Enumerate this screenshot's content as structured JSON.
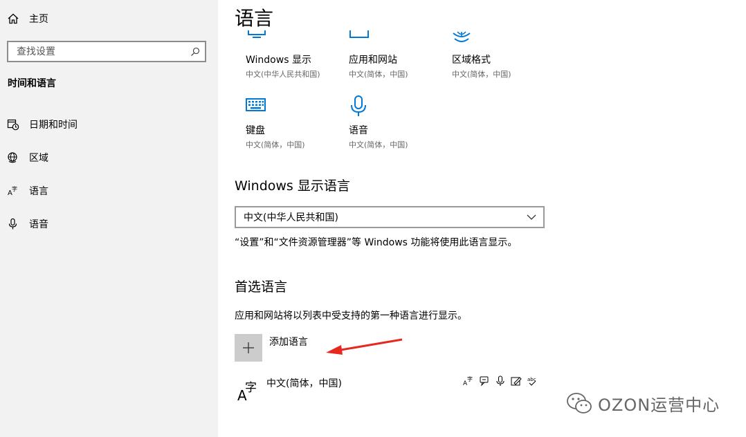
{
  "sidebar": {
    "home_label": "主页",
    "search_placeholder": "查找设置",
    "section_title": "时间和语言",
    "items": [
      {
        "label": "日期和时间"
      },
      {
        "label": "区域"
      },
      {
        "label": "语言"
      },
      {
        "label": "语音"
      }
    ]
  },
  "main": {
    "title": "语言",
    "tiles": [
      {
        "name": "Windows 显示",
        "sub": "中文(中华人民共和国)",
        "icon": "monitor-icon"
      },
      {
        "name": "应用和网站",
        "sub": "中文(简体，中国)",
        "icon": "window-icon"
      },
      {
        "name": "区域格式",
        "sub": "中文(简体，中国)",
        "icon": "globe-icon"
      },
      {
        "name": "键盘",
        "sub": "中文(简体，中国)",
        "icon": "keyboard-icon"
      },
      {
        "name": "语音",
        "sub": "中文(简体，中国)",
        "icon": "microphone-icon"
      }
    ],
    "display_language": {
      "heading": "Windows 显示语言",
      "selected": "中文(中华人民共和国)",
      "description": "“设置”和“文件资源管理器”等 Windows 功能将使用此语言显示。"
    },
    "preferred": {
      "heading": "首选语言",
      "description": "应用和网站将以列表中受支持的第一种语言进行显示。",
      "add_label": "添加语言",
      "languages": [
        {
          "name": "中文(简体，中国)"
        }
      ]
    }
  },
  "watermark": {
    "text": "OZON运营中心"
  },
  "colors": {
    "accent": "#0078d7",
    "sidebar_bg": "#f2f2f2",
    "arrow": "#e8271f"
  }
}
